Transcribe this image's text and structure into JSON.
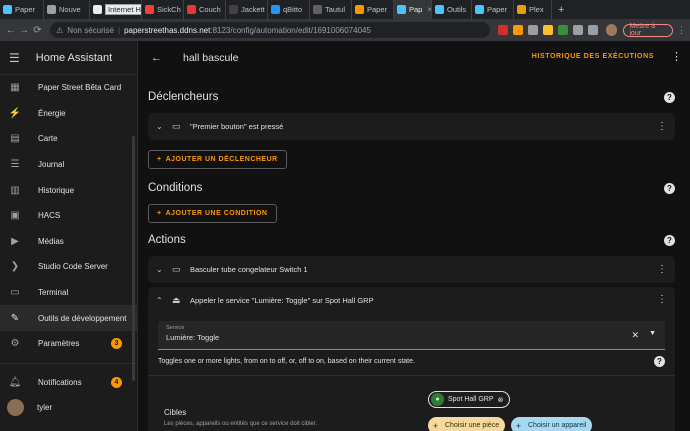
{
  "browser": {
    "tabs": [
      {
        "label": "Paper",
        "color": "#4fc3f7",
        "active": false,
        "boxed": false
      },
      {
        "label": "Nouve",
        "color": "#9aa0a6",
        "active": false,
        "boxed": false
      },
      {
        "label": "Internet HAS",
        "color": "#e8eaed",
        "active": false,
        "boxed": true
      },
      {
        "label": "SickCh",
        "color": "#f44336",
        "active": false,
        "boxed": false
      },
      {
        "label": "Couch",
        "color": "#e53935",
        "active": false,
        "boxed": false
      },
      {
        "label": "Jackett",
        "color": "#424242",
        "active": false,
        "boxed": false
      },
      {
        "label": "qBitto",
        "color": "#2196f3",
        "active": false,
        "boxed": false
      },
      {
        "label": "Tautul",
        "color": "#616161",
        "active": false,
        "boxed": false
      },
      {
        "label": "Paper",
        "color": "#ff9800",
        "active": false,
        "boxed": false
      },
      {
        "label": "Pap",
        "color": "#4fc3f7",
        "active": true,
        "boxed": false
      },
      {
        "label": "Outils",
        "color": "#4fc3f7",
        "active": false,
        "boxed": false
      },
      {
        "label": "Paper",
        "color": "#4fc3f7",
        "active": false,
        "boxed": false
      },
      {
        "label": "Plex",
        "color": "#e5a00d",
        "active": false,
        "boxed": false
      }
    ],
    "new_tab_glyph": "+",
    "nav": {
      "back": "←",
      "forward": "→",
      "reload": "⟳"
    },
    "address": {
      "security": "Non sécurisé",
      "host": "paperstreethas.ddns.net",
      "path": ":8123/config/automation/edit/1691006074045"
    },
    "update_button": "Mettre à jour",
    "extension_colors": [
      "#d32f2f",
      "#ff9800",
      "#9e9e9e",
      "#fbc02d",
      "#388e3c",
      "#9aa0a6",
      "#9aa0a6"
    ]
  },
  "sidebar": {
    "title": "Home Assistant",
    "items": [
      {
        "label": "Paper Street Bêta Card",
        "icon": "dashboard-icon",
        "glyph": "▦"
      },
      {
        "label": "Énergie",
        "icon": "lightning-icon",
        "glyph": "⚡"
      },
      {
        "label": "Carte",
        "icon": "map-icon",
        "glyph": "▤"
      },
      {
        "label": "Journal",
        "icon": "logbook-icon",
        "glyph": "☰"
      },
      {
        "label": "Historique",
        "icon": "history-icon",
        "glyph": "▥"
      },
      {
        "label": "HACS",
        "icon": "hacs-icon",
        "glyph": "▣"
      },
      {
        "label": "Médias",
        "icon": "media-icon",
        "glyph": "▶"
      },
      {
        "label": "Studio Code Server",
        "icon": "vscode-icon",
        "glyph": "❯"
      },
      {
        "label": "Terminal",
        "icon": "terminal-icon",
        "glyph": "▭"
      },
      {
        "label": "Outils de développement",
        "icon": "wrench-icon",
        "glyph": "✎"
      },
      {
        "label": "Paramètres",
        "icon": "gear-icon",
        "glyph": "⚙",
        "badge": "3"
      }
    ],
    "notifications": {
      "label": "Notifications",
      "badge": "4"
    },
    "user": {
      "name": "tyler"
    }
  },
  "main": {
    "title": "hall bascule",
    "history_button": "HISTORIQUE DES EXÉCUTIONS",
    "triggers": {
      "heading": "Déclencheurs",
      "item": "\"Premier bouton\" est pressé",
      "add_button": "AJOUTER UN DÉCLENCHEUR"
    },
    "conditions": {
      "heading": "Conditions",
      "add_button": "AJOUTER UNE CONDITION"
    },
    "actions": {
      "heading": "Actions",
      "item1": "Basculer tube congelateur Switch 1",
      "item2": "Appeler le service \"Lumière: Toggle\" sur Spot Hall GRP",
      "service_label": "Service",
      "service_value": "Lumière: Toggle",
      "service_description": "Toggles one or more lights, from on to off, or, off to on, based on their current state.",
      "targets_label": "Cibles",
      "targets_desc": "Les pièces, appareils ou entités que ce service doit cibler.",
      "entity_chip": "Spot Hall GRP",
      "choose_area": "Choisir une pièce",
      "choose_device": "Choisir un appareil"
    }
  }
}
